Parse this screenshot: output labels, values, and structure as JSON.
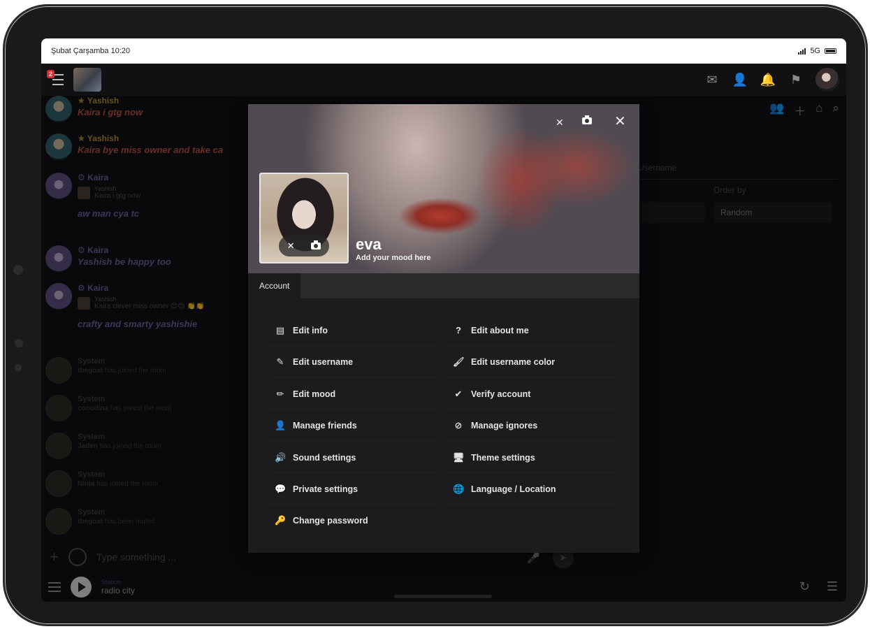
{
  "status_bar": {
    "left": "Şubat Çarşamba 10:20",
    "network": "5G"
  },
  "topbar": {
    "notification_count": "2"
  },
  "chat": {
    "messages": [
      {
        "name": "Yashish",
        "text": "Kaira i gtg now"
      },
      {
        "name": "Yashish",
        "text": "Kaira bye miss owner and take ca"
      },
      {
        "name": "Kaira",
        "quote_user": "Yashish",
        "quote_text": "Kaira i gtg now",
        "text": "aw man cya tc"
      },
      {
        "name": "Kaira",
        "text": "Yashish be happy too"
      },
      {
        "name": "Kaira",
        "quote_user": "Yashish",
        "quote_text": "Kaira clever miss owner 😊😊 👏👏",
        "text": "crafty and smarty yashishie"
      }
    ],
    "system_messages": [
      {
        "name": "System",
        "user": "thegoat",
        "text": "has joined the room"
      },
      {
        "name": "System",
        "user": "cocodina",
        "text": "has joined the room"
      },
      {
        "name": "System",
        "user": "Jaden",
        "text": "has joined the room"
      },
      {
        "name": "System",
        "user": "Ninja",
        "text": "has joined the room"
      },
      {
        "name": "System",
        "user": "thegoat",
        "text": "has been muted"
      }
    ]
  },
  "background_panel": {
    "search_placeholder": "Username",
    "order_by_label": "Order by",
    "order_by_value": "Random"
  },
  "input": {
    "placeholder": "Type something ..."
  },
  "player": {
    "label": "Station",
    "station": "radio city"
  },
  "profile_modal": {
    "username": "eva",
    "mood": "Add your mood here",
    "tabs": [
      "Account"
    ],
    "options_left": [
      {
        "icon": "id-card-icon",
        "glyph": "▤",
        "label": "Edit info"
      },
      {
        "icon": "edit-icon",
        "glyph": "✎",
        "label": "Edit username"
      },
      {
        "icon": "pencil-icon",
        "glyph": "✏",
        "label": "Edit mood"
      },
      {
        "icon": "user-plus-icon",
        "glyph": "👤",
        "label": "Manage friends"
      },
      {
        "icon": "volume-icon",
        "glyph": "🔊",
        "label": "Sound settings"
      },
      {
        "icon": "chat-icon",
        "glyph": "💬",
        "label": "Private settings"
      },
      {
        "icon": "key-icon",
        "glyph": "🔑",
        "label": "Change password"
      }
    ],
    "options_right": [
      {
        "icon": "question-icon",
        "glyph": "?",
        "label": "Edit about me"
      },
      {
        "icon": "brush-icon",
        "glyph": "🖌",
        "label": "Edit username color"
      },
      {
        "icon": "check-icon",
        "glyph": "✔",
        "label": "Verify account"
      },
      {
        "icon": "ban-icon",
        "glyph": "⊘",
        "label": "Manage ignores"
      },
      {
        "icon": "monitor-icon",
        "glyph": "🖥",
        "label": "Theme settings"
      },
      {
        "icon": "globe-icon",
        "glyph": "🌐",
        "label": "Language / Location"
      }
    ]
  }
}
